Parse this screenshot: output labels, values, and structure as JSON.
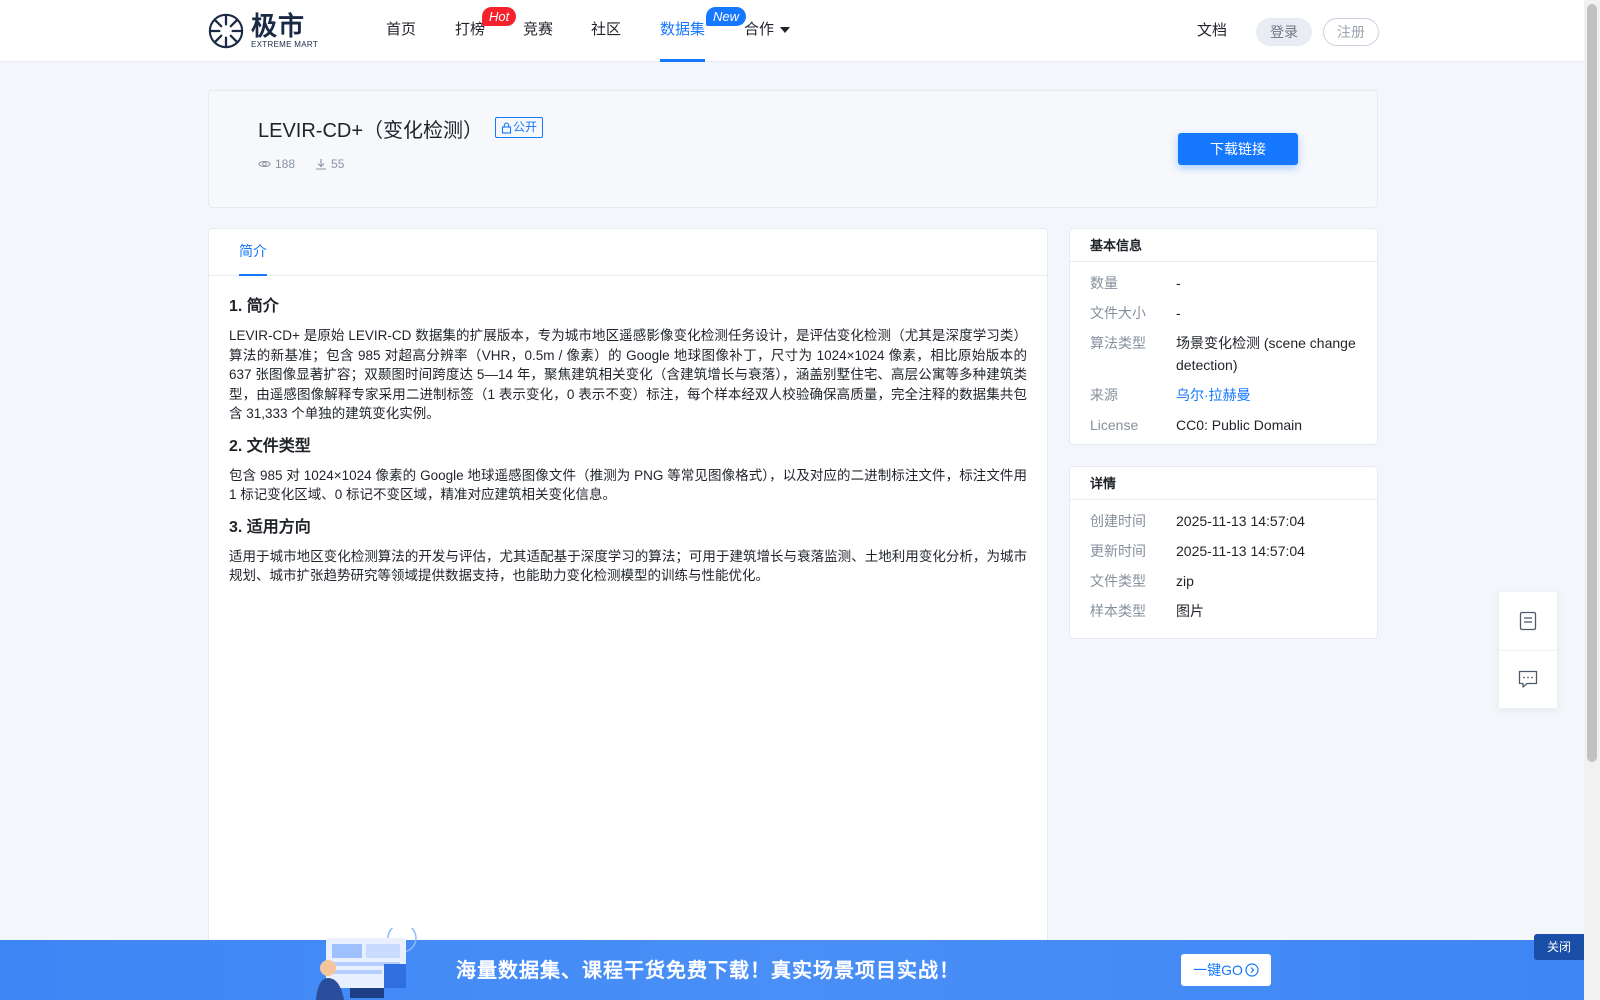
{
  "brand": {
    "name_cn": "极市",
    "name_en": "EXTREME MART"
  },
  "nav": {
    "items": [
      {
        "label": "首页"
      },
      {
        "label": "打榜",
        "badge": "Hot"
      },
      {
        "label": "竞赛"
      },
      {
        "label": "社区"
      },
      {
        "label": "数据集",
        "badge": "New",
        "active": true
      },
      {
        "label": "合作",
        "dropdown": true
      }
    ],
    "docs": "文档",
    "login": "登录",
    "register": "注册"
  },
  "dataset": {
    "title": "LEVIR-CD+（变化检测）",
    "visibility": "公开",
    "views": "188",
    "downloads": "55",
    "download_button": "下载链接"
  },
  "tabs": [
    {
      "label": "简介",
      "active": true
    }
  ],
  "content": {
    "sections": [
      {
        "heading": "1. 简介",
        "text": "LEVIR-CD+ 是原始 LEVIR-CD 数据集的扩展版本，专为城市地区遥感影像变化检测任务设计，是评估变化检测（尤其是深度学习类）算法的新基准；包含 985 对超高分辨率（VHR，0.5m / 像素）的 Google 地球图像补丁，尺寸为 1024×1024 像素，相比原始版本的 637 张图像显著扩容；双颞图时间跨度达 5—14 年，聚焦建筑相关变化（含建筑增长与衰落），涵盖别墅住宅、高层公寓等多种建筑类型，由遥感图像解释专家采用二进制标签（1 表示变化，0 表示不变）标注，每个样本经双人校验确保高质量，完全注释的数据集共包含 31,333 个单独的建筑变化实例。"
      },
      {
        "heading": "2. 文件类型",
        "text": "包含 985 对 1024×1024 像素的 Google 地球遥感图像文件（推测为 PNG 等常见图像格式），以及对应的二进制标注文件，标注文件用 1 标记变化区域、0 标记不变区域，精准对应建筑相关变化信息。"
      },
      {
        "heading": "3. 适用方向",
        "text": "适用于城市地区变化检测算法的开发与评估，尤其适配基于深度学习的算法；可用于建筑增长与衰落监测、土地利用变化分析，为城市规划、城市扩张趋势研究等领域提供数据支持，也能助力变化检测模型的训练与性能优化。"
      }
    ]
  },
  "basic_info": {
    "title": "基本信息",
    "rows": [
      {
        "key": "数量",
        "value": "-"
      },
      {
        "key": "文件大小",
        "value": "-"
      },
      {
        "key": "算法类型",
        "value": "场景变化检测 (scene change detection)"
      },
      {
        "key": "来源",
        "value": "乌尔·拉赫曼",
        "link": true
      },
      {
        "key": "License",
        "value": "CC0: Public Domain"
      }
    ]
  },
  "details": {
    "title": "详情",
    "rows": [
      {
        "key": "创建时间",
        "value": "2025-11-13 14:57:04"
      },
      {
        "key": "更新时间",
        "value": "2025-11-13 14:57:04"
      },
      {
        "key": "文件类型",
        "value": "zip"
      },
      {
        "key": "样本类型",
        "value": "图片"
      }
    ]
  },
  "banner": {
    "text": "海量数据集、课程干货免费下载！真实场景项目实战！",
    "go_button": "一键GO",
    "close": "关闭"
  },
  "colors": {
    "accent": "#1677ff",
    "hot": "#f5222d",
    "banner": "#4a8ff7"
  },
  "icons": [
    "eye-icon",
    "download-icon",
    "lock-icon",
    "caret-down-icon",
    "notes-icon",
    "message-icon",
    "arrow-circle-icon"
  ]
}
